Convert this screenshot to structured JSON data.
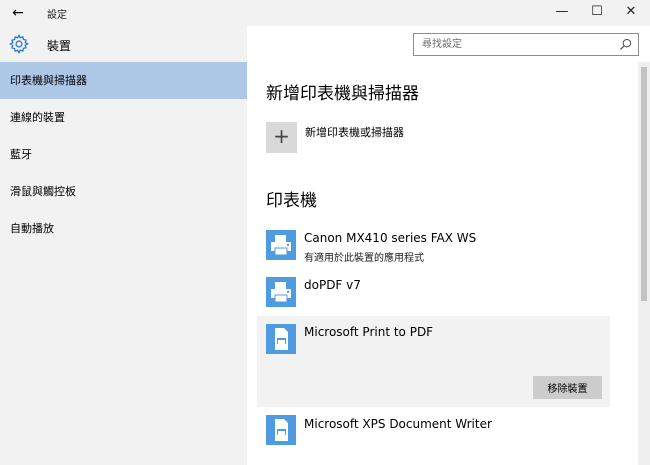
{
  "window": {
    "back_glyph": "←",
    "title": "設定",
    "minimize_glyph": "—",
    "maximize_glyph": "☐",
    "close_glyph": "✕"
  },
  "sidebar": {
    "title": "裝置",
    "icon": "gear-icon",
    "items": [
      {
        "label": "印表機與掃描器",
        "active": true
      },
      {
        "label": "連線的裝置",
        "active": false
      },
      {
        "label": "藍牙",
        "active": false
      },
      {
        "label": "滑鼠與觸控板",
        "active": false
      },
      {
        "label": "自動播放",
        "active": false
      }
    ]
  },
  "search": {
    "placeholder": "尋找設定",
    "value": ""
  },
  "main": {
    "add_section_title": "新增印表機與掃描器",
    "add_button_glyph": "+",
    "add_button_label": "新增印表機或掃描器",
    "printers_section_title": "印表機",
    "printers": [
      {
        "name": "Canon MX410 series FAX WS",
        "subtitle": "有適用於此裝置的應用程式",
        "icon": "fax-printer-icon"
      },
      {
        "name": "doPDF v7",
        "subtitle": "",
        "icon": "printer-icon"
      },
      {
        "name": "Microsoft Print to PDF",
        "subtitle": "",
        "icon": "pdf-printer-icon",
        "selected": true,
        "action_label": "移除裝置"
      },
      {
        "name": "Microsoft XPS Document Writer",
        "subtitle": "",
        "icon": "xps-printer-icon"
      }
    ]
  },
  "colors": {
    "accent": "#4f9be0",
    "nav_active": "#adc7e6",
    "sidebar_bg": "#f2f2f2"
  }
}
